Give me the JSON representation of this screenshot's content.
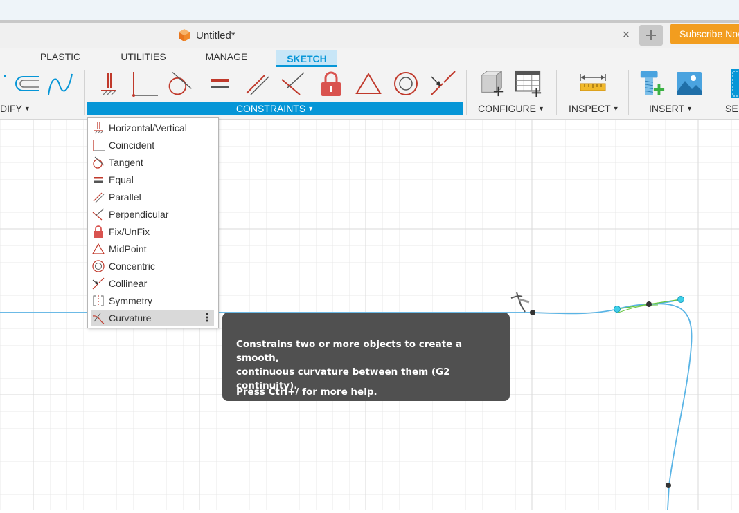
{
  "document": {
    "title": "Untitled*"
  },
  "header": {
    "subscribe_label": "Subscribe Now",
    "close_icon": "×"
  },
  "workspace_tabs": [
    {
      "label": "PLASTIC",
      "active": false
    },
    {
      "label": "UTILITIES",
      "active": false
    },
    {
      "label": "MANAGE",
      "active": false
    },
    {
      "label": "SKETCH",
      "active": true
    }
  ],
  "toolbar": {
    "modify_label": "DIFY",
    "constraints_label": "CONSTRAINTS",
    "configure_label": "CONFIGURE",
    "inspect_label": "INSPECT",
    "insert_label": "INSERT",
    "select_label": "SE"
  },
  "constraints_menu": {
    "items": [
      {
        "label": "Horizontal/Vertical",
        "icon": "horizontal-vertical-icon"
      },
      {
        "label": "Coincident",
        "icon": "coincident-icon"
      },
      {
        "label": "Tangent",
        "icon": "tangent-icon"
      },
      {
        "label": "Equal",
        "icon": "equal-icon"
      },
      {
        "label": "Parallel",
        "icon": "parallel-icon"
      },
      {
        "label": "Perpendicular",
        "icon": "perpendicular-icon"
      },
      {
        "label": "Fix/UnFix",
        "icon": "lock-icon"
      },
      {
        "label": "MidPoint",
        "icon": "midpoint-icon"
      },
      {
        "label": "Concentric",
        "icon": "concentric-icon"
      },
      {
        "label": "Collinear",
        "icon": "collinear-icon"
      },
      {
        "label": "Symmetry",
        "icon": "symmetry-icon"
      },
      {
        "label": "Curvature",
        "icon": "curvature-icon",
        "highlighted": true
      }
    ]
  },
  "tooltip": {
    "line1": "Constrains two or more objects to create a smooth,",
    "line2": "continuous curvature between them (G2 continuity).",
    "help": "Press Ctrl+/ for more help."
  },
  "colors": {
    "accent": "#0696d7",
    "constraint_red": "#c0392b",
    "subscribe": "#f29d1f",
    "sketch_curve": "#5ab4e5",
    "tooltip_bg": "#505050"
  }
}
